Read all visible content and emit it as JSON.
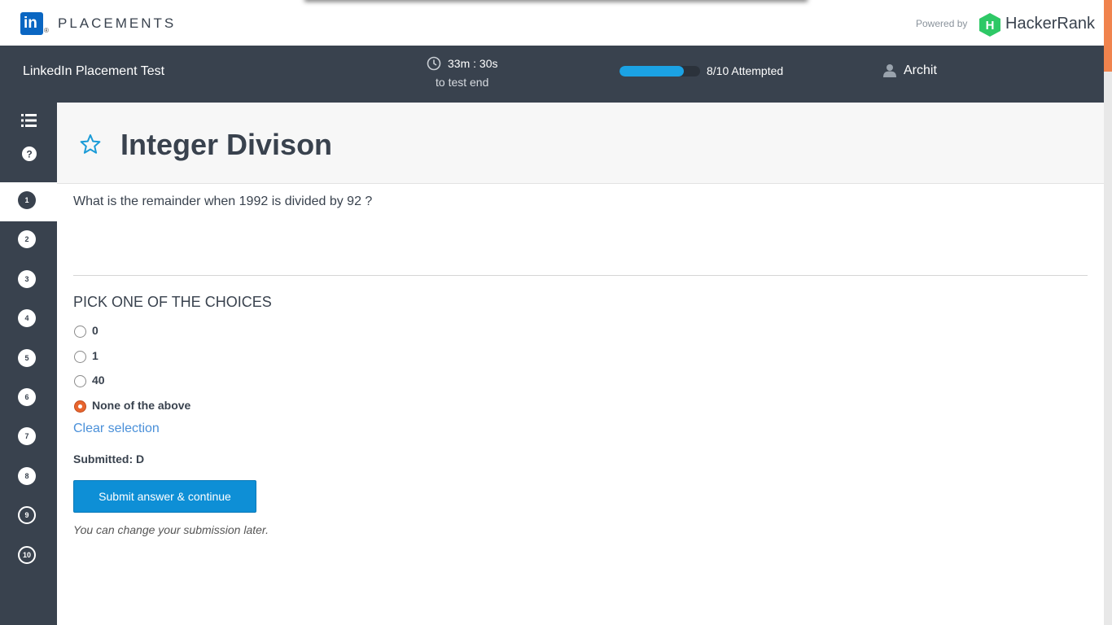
{
  "brand": {
    "name": "PLACEMENTS",
    "logo_text": "in",
    "registered_mark": "®",
    "powered_by": "Powered by",
    "partner_name": "HackerRank",
    "partner_logo_letter": "H"
  },
  "header": {
    "test_name": "LinkedIn Placement Test",
    "timer": {
      "value": "33m : 30s",
      "caption": "to test end",
      "icon": "clock-icon"
    },
    "progress": {
      "attempted": 8,
      "total": 10,
      "fraction": 0.8,
      "label": "8/10 Attempted",
      "color": "#1ba2e4"
    },
    "user": {
      "name": "Archit",
      "icon": "user-icon"
    }
  },
  "sidebar": {
    "icons": [
      "list-icon",
      "help-icon"
    ],
    "questions": [
      {
        "label": "1",
        "status": "active"
      },
      {
        "label": "2",
        "status": "attempted"
      },
      {
        "label": "3",
        "status": "attempted"
      },
      {
        "label": "4",
        "status": "attempted"
      },
      {
        "label": "5",
        "status": "attempted"
      },
      {
        "label": "6",
        "status": "attempted"
      },
      {
        "label": "7",
        "status": "attempted"
      },
      {
        "label": "8",
        "status": "attempted"
      },
      {
        "label": "9",
        "status": "unattempted"
      },
      {
        "label": "10",
        "status": "unattempted"
      }
    ]
  },
  "question": {
    "title": "Integer Divison",
    "text": "What is the remainder when 1992 is divided by 92 ?",
    "pick_label": "PICK ONE OF THE CHOICES",
    "options": [
      {
        "label": "0",
        "selected": false
      },
      {
        "label": "1",
        "selected": false
      },
      {
        "label": "40",
        "selected": false
      },
      {
        "label": "None of the above",
        "selected": true
      }
    ],
    "clear_label": "Clear selection",
    "submitted_text": "Submitted: D",
    "submit_button": "Submit answer & continue",
    "note": "You can change your submission later."
  },
  "colors": {
    "header_bg": "#39424e",
    "accent_blue": "#0e8fd6",
    "link_blue": "#4a90d9",
    "selected_radio": "#e8652e",
    "scrollbar_thumb": "#f0834d"
  }
}
